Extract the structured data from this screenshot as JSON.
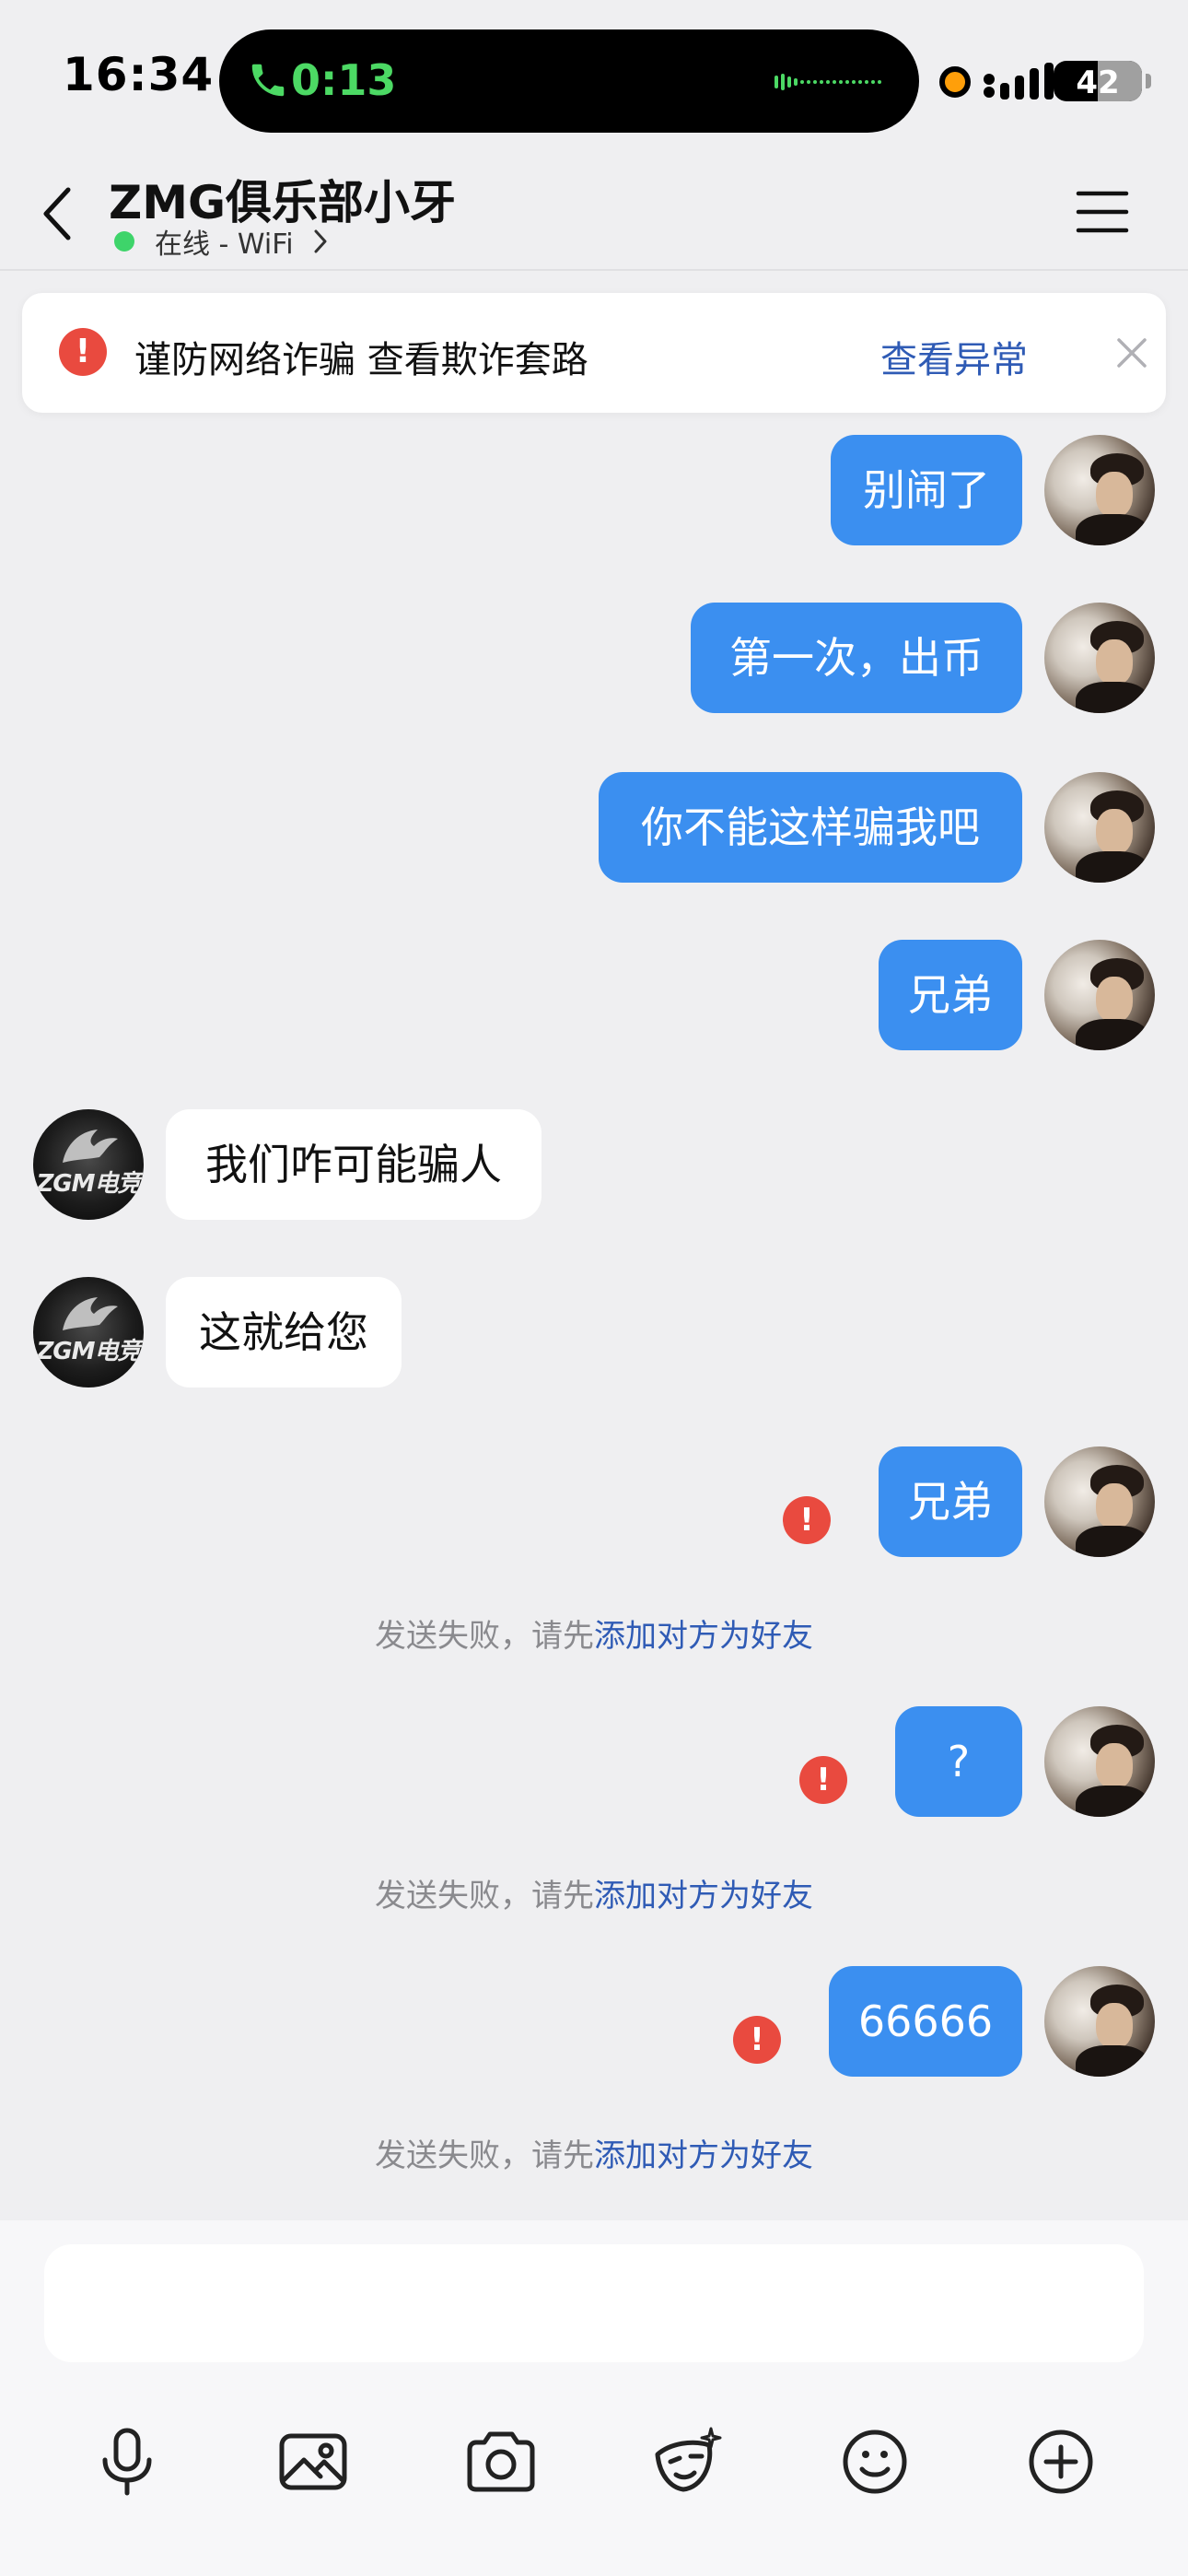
{
  "status_bar": {
    "time": "16:34",
    "call_timer": "0:13",
    "battery": "42",
    "accent_call": "#4cd964"
  },
  "header": {
    "title": "ZMG俱乐部小牙",
    "status": "在线 - WiFi"
  },
  "warning": {
    "text": "谨防网络诈骗 查看欺诈套路",
    "action": "查看异常"
  },
  "messages": [
    {
      "side": "out",
      "text": "别闹了",
      "failed": false
    },
    {
      "side": "out",
      "text": "第一次，出币",
      "failed": false
    },
    {
      "side": "out",
      "text": "你不能这样骗我吧",
      "failed": false
    },
    {
      "side": "out",
      "text": "兄弟",
      "failed": false
    },
    {
      "side": "in",
      "text": "我们咋可能骗人",
      "failed": false
    },
    {
      "side": "in",
      "text": "这就给您",
      "failed": false
    },
    {
      "side": "out",
      "text": "兄弟",
      "failed": true
    },
    {
      "side": "out",
      "text": "?",
      "failed": true
    },
    {
      "side": "out",
      "text": "66666",
      "failed": true
    }
  ],
  "fail_note": {
    "prefix": "发送失败，请先",
    "link": "添加对方为好友"
  },
  "contact_avatar": {
    "logo_text": "ZGM电竞"
  },
  "input": {
    "placeholder": ""
  },
  "toolbar": {
    "icons": [
      "microphone-icon",
      "image-icon",
      "camera-icon",
      "mask-icon",
      "emoji-icon",
      "plus-icon"
    ]
  },
  "colors": {
    "bubble_out": "#3b8ff0",
    "link": "#2f5bb5",
    "error": "#e94a3f",
    "online": "#3ed46a"
  }
}
